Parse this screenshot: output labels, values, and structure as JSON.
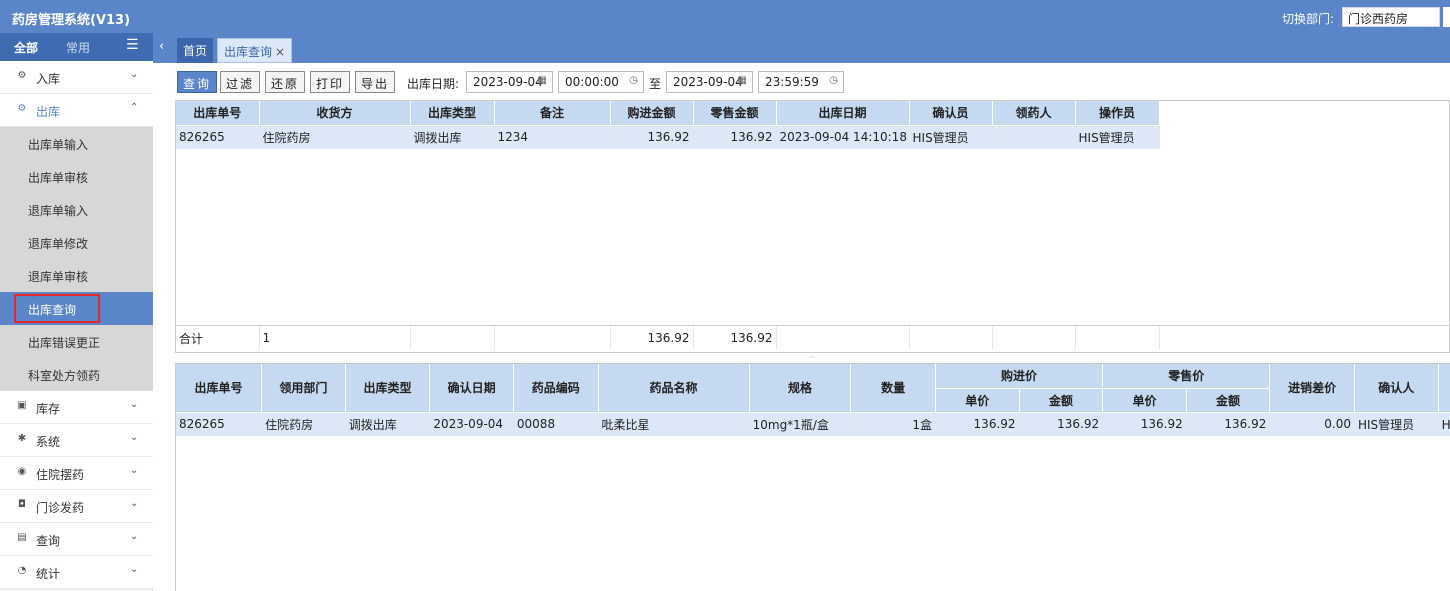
{
  "header": {
    "title": "药房管理系统(V13)",
    "dept_label": "切换部门:",
    "dept_value": "门诊西药房"
  },
  "sidebar": {
    "tabs": {
      "all": "全部",
      "common": "常用"
    },
    "groups": [
      {
        "label": "入库",
        "icon": "gear-icon"
      },
      {
        "label": "出库",
        "icon": "gear-icon"
      },
      {
        "label": "库存",
        "icon": "calendar-icon"
      },
      {
        "label": "系统",
        "icon": "settings-icon"
      },
      {
        "label": "住院摆药",
        "icon": "target-icon"
      },
      {
        "label": "门诊发药",
        "icon": "bag-icon"
      },
      {
        "label": "查询",
        "icon": "doc-icon"
      },
      {
        "label": "统计",
        "icon": "chart-icon"
      }
    ],
    "sub_items": [
      "出库单输入",
      "出库单审核",
      "退库单输入",
      "退库单修改",
      "退库单审核",
      "出库查询",
      "出库错误更正",
      "科室处方领药"
    ],
    "active": "出库查询"
  },
  "tabs": {
    "home": "首页",
    "current": "出库查询"
  },
  "toolbar": {
    "buttons": [
      "查询",
      "过滤",
      "还原",
      "打印",
      "导出"
    ],
    "date_label": "出库日期:",
    "start_date": "2023-09-04",
    "start_time": "00:00:00",
    "to_label": "至",
    "end_date": "2023-09-04",
    "end_time": "23:59:59"
  },
  "grid_top": {
    "columns": [
      "出库单号",
      "收货方",
      "出库类型",
      "备注",
      "购进金额",
      "零售金额",
      "出库日期",
      "确认员",
      "领药人",
      "操作员"
    ],
    "rows": [
      [
        "826265",
        "住院药房",
        "调拨出库",
        "1234",
        "136.92",
        "136.92",
        "2023-09-04 14:10:18",
        "HIS管理员",
        "",
        "HIS管理员"
      ]
    ],
    "footer": [
      "合计",
      "1",
      "",
      "",
      "136.92",
      "136.92",
      "",
      "",
      "",
      ""
    ]
  },
  "grid_bottom": {
    "columns": [
      "出库单号",
      "领用部门",
      "出库类型",
      "确认日期",
      "药品编码",
      "药品名称",
      "规格",
      "数量",
      "购进价",
      "零售价",
      "进销差价",
      "确认人",
      ""
    ],
    "sub_columns": [
      "单价",
      "金额",
      "单价",
      "金额"
    ],
    "rows": [
      [
        "826265",
        "住院药房",
        "调拨出库",
        "2023-09-04",
        "00088",
        "吡柔比星",
        "10mg*1瓶/盒",
        "1盒",
        "136.92",
        "136.92",
        "136.92",
        "136.92",
        "0.00",
        "HIS管理员",
        "HIS管"
      ]
    ]
  }
}
